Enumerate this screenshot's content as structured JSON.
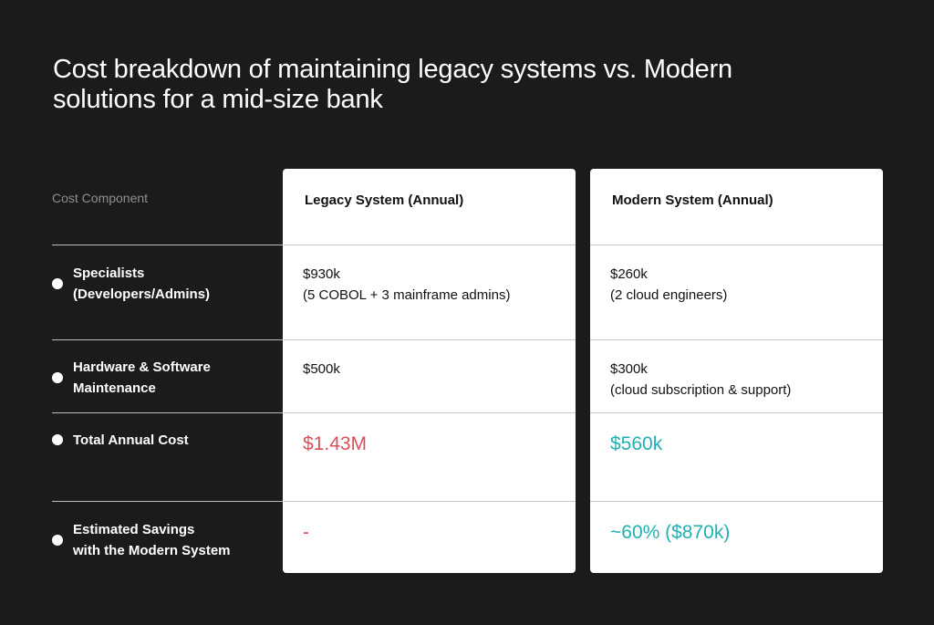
{
  "title": "Cost breakdown of maintaining legacy systems vs. Modern solutions for a mid-size bank",
  "colors": {
    "background": "#1c1b1c",
    "legacy_accent": "#d8505b",
    "modern_accent": "#22b0b3"
  },
  "table": {
    "label_header": "Cost Component",
    "rows": [
      {
        "line1": "Specialists",
        "line2": "(Developers/Admins)"
      },
      {
        "line1": "Hardware & Software",
        "line2": "Maintenance"
      },
      {
        "line1": "Total Annual Cost",
        "line2": ""
      },
      {
        "line1": "Estimated Savings",
        "line2": "with the Modern System"
      }
    ],
    "legacy": {
      "header": "Legacy System (Annual)",
      "specialists_value": "$930k",
      "specialists_note": "(5 COBOL + 3 mainframe admins)",
      "hardware_value": "$500k",
      "hardware_note": "",
      "total": "$1.43M",
      "savings": "-"
    },
    "modern": {
      "header": "Modern System (Annual)",
      "specialists_value": "$260k",
      "specialists_note": "(2 cloud engineers)",
      "hardware_value": "$300k",
      "hardware_note": "(cloud subscription & support)",
      "total": "$560k",
      "savings": "~60% ($870k)"
    }
  }
}
